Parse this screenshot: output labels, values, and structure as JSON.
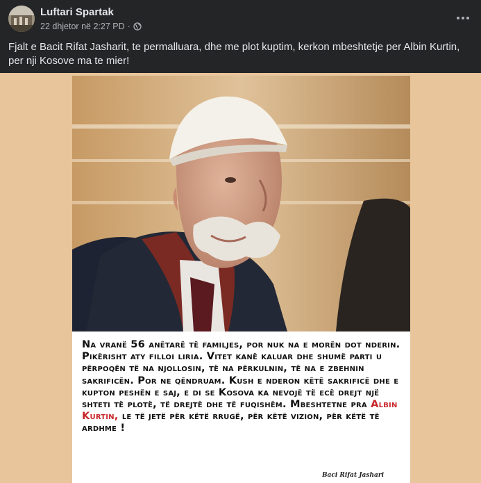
{
  "post": {
    "author": "Luftari Spartak",
    "timestamp": "22 dhjetor në 2:27 PD",
    "separator": "·",
    "privacy_icon": "globe-icon",
    "more_icon": "more-options-icon",
    "text": "Fjalt e Bacit Rifat Jasharit, te permalluara, dhe me plot kuptim,  kerkon mbeshtetje per Albin Kurtin, per nji Kosove ma te mier!"
  },
  "image": {
    "quote_before": "Na vranë 56 anëtarë të familjes, por nuk na e morën dot nderin. Pikërisht aty filloi liria. Vitet kanë kaluar dhe shumë parti u përpoqën të na njollosin, të na përkulnin, të na e zbehnin sakrificën. Por ne qëndruam. Kush e nderon këtë sakrificë dhe e kupton peshën e saj, e di se Kosova ka nevojë të ecë drejt një shteti të plotë, të drejtë dhe të fuqishëm. Mbeshtetne pra ",
    "quote_highlight": "Albin Kurtin,",
    "quote_after": "  le të jetë për këtë rrugë, për këtë vizion, për këtë të ardhme !",
    "signature": "Baci Rifat Jashari"
  },
  "colors": {
    "background": "#242526",
    "image_backdrop": "#e8c59b",
    "highlight": "#c8262a",
    "secondary_text": "#b0b3b8"
  }
}
